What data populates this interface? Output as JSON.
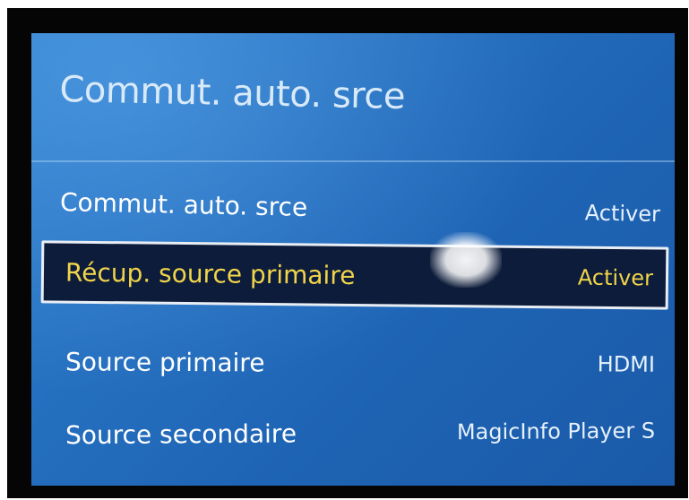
{
  "menu": {
    "title": "Commut. auto. srce",
    "items": [
      {
        "label": "Commut. auto. srce",
        "value": "Activer",
        "selected": false
      },
      {
        "label": "Récup. source primaire",
        "value": "Activer",
        "selected": true
      },
      {
        "label": "Source primaire",
        "value": "HDMI",
        "selected": false
      },
      {
        "label": "Source secondaire",
        "value": "MagicInfo Player S",
        "selected": false
      }
    ]
  },
  "colors": {
    "screen_blue": "#256fbf",
    "selection_bg": "#0d1c3a",
    "selection_text": "#f0d44a",
    "text": "#ffffff"
  }
}
